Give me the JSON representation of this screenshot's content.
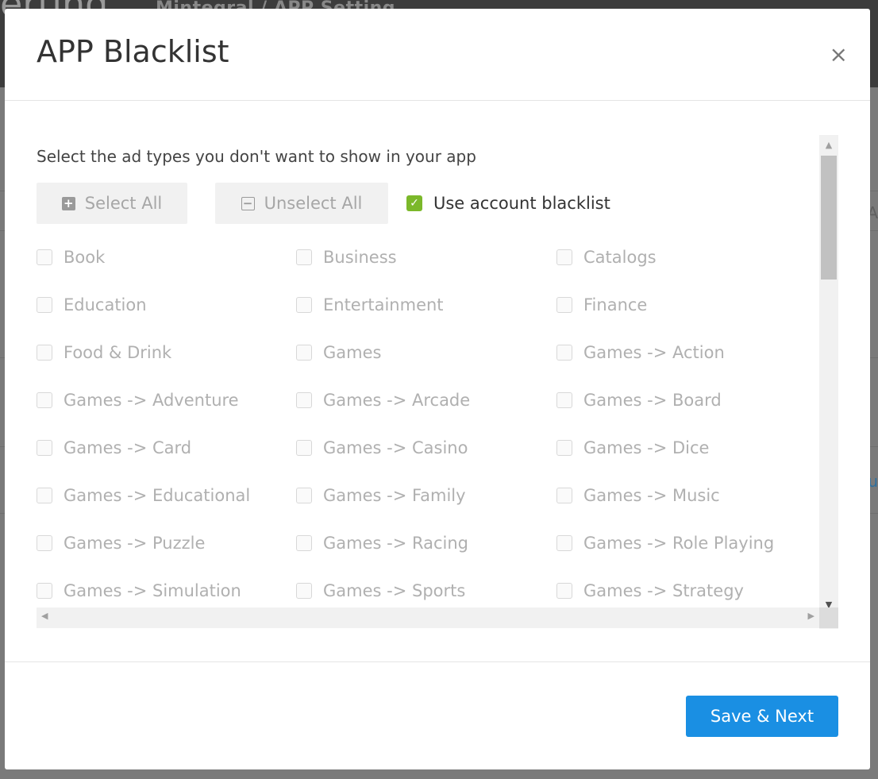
{
  "background": {
    "logo_fragment": "erting",
    "header_text": "Mintegral / APP Setting",
    "side_text_1": "A",
    "side_link": "u"
  },
  "modal": {
    "title": "APP Blacklist",
    "close_symbol": "×",
    "instruction": "Select the ad types you don't want to show in your app",
    "select_all_label": "Select All",
    "unselect_all_label": "Unselect All",
    "use_account_blacklist_label": "Use account blacklist",
    "use_account_blacklist_checked": true,
    "categories": [
      "Book",
      "Business",
      "Catalogs",
      "Education",
      "Entertainment",
      "Finance",
      "Food & Drink",
      "Games",
      "Games -> Action",
      "Games -> Adventure",
      "Games -> Arcade",
      "Games -> Board",
      "Games -> Card",
      "Games -> Casino",
      "Games -> Dice",
      "Games -> Educational",
      "Games -> Family",
      "Games -> Music",
      "Games -> Puzzle",
      "Games -> Racing",
      "Games -> Role Playing",
      "Games -> Simulation",
      "Games -> Sports",
      "Games -> Strategy"
    ],
    "save_button_label": "Save & Next"
  },
  "colors": {
    "primary_button": "#1a8fe3",
    "checkbox_checked": "#7bb82a",
    "disabled_text": "#b0b0b0"
  }
}
